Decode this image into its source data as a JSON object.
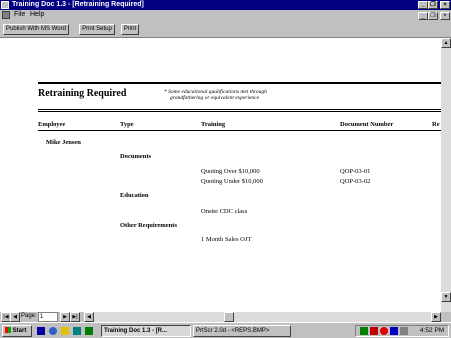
{
  "window": {
    "title": "Training Doc 1.3 - [Retraining Required]"
  },
  "menu": {
    "file": "File",
    "help": "Help"
  },
  "toolbar": {
    "publish": "Publish With MS Word",
    "print_setup": "Print Setup",
    "print": "Print"
  },
  "report": {
    "title": "Retraining Required",
    "note_line1": "* Some educational qualifications met through",
    "note_line2": "grandfathering or equivalent experience",
    "columns": {
      "employee": "Employee",
      "type": "Type",
      "training": "Training",
      "document_number": "Document Number",
      "re": "Re"
    },
    "employee_name": "Mike Jensen",
    "types": {
      "documents": "Documents",
      "education": "Education",
      "other": "Other Requirements"
    },
    "rows": [
      {
        "training": "Quoting Over $10,000",
        "doc": "QOP-03-01"
      },
      {
        "training": "Quoting Under $10,000",
        "doc": "QOP-03-02"
      },
      {
        "training": "Onsite CDC class",
        "doc": ""
      },
      {
        "training": "1 Month Sales OJT",
        "doc": ""
      }
    ]
  },
  "nav": {
    "page_label": "Page:",
    "page_value": "1"
  },
  "taskbar": {
    "start": "Start",
    "task1": "Training Doc 1.3 - [R...",
    "task2": "PrtScr 2.0d - <REPS.BMP>",
    "clock": "4:52 PM"
  }
}
